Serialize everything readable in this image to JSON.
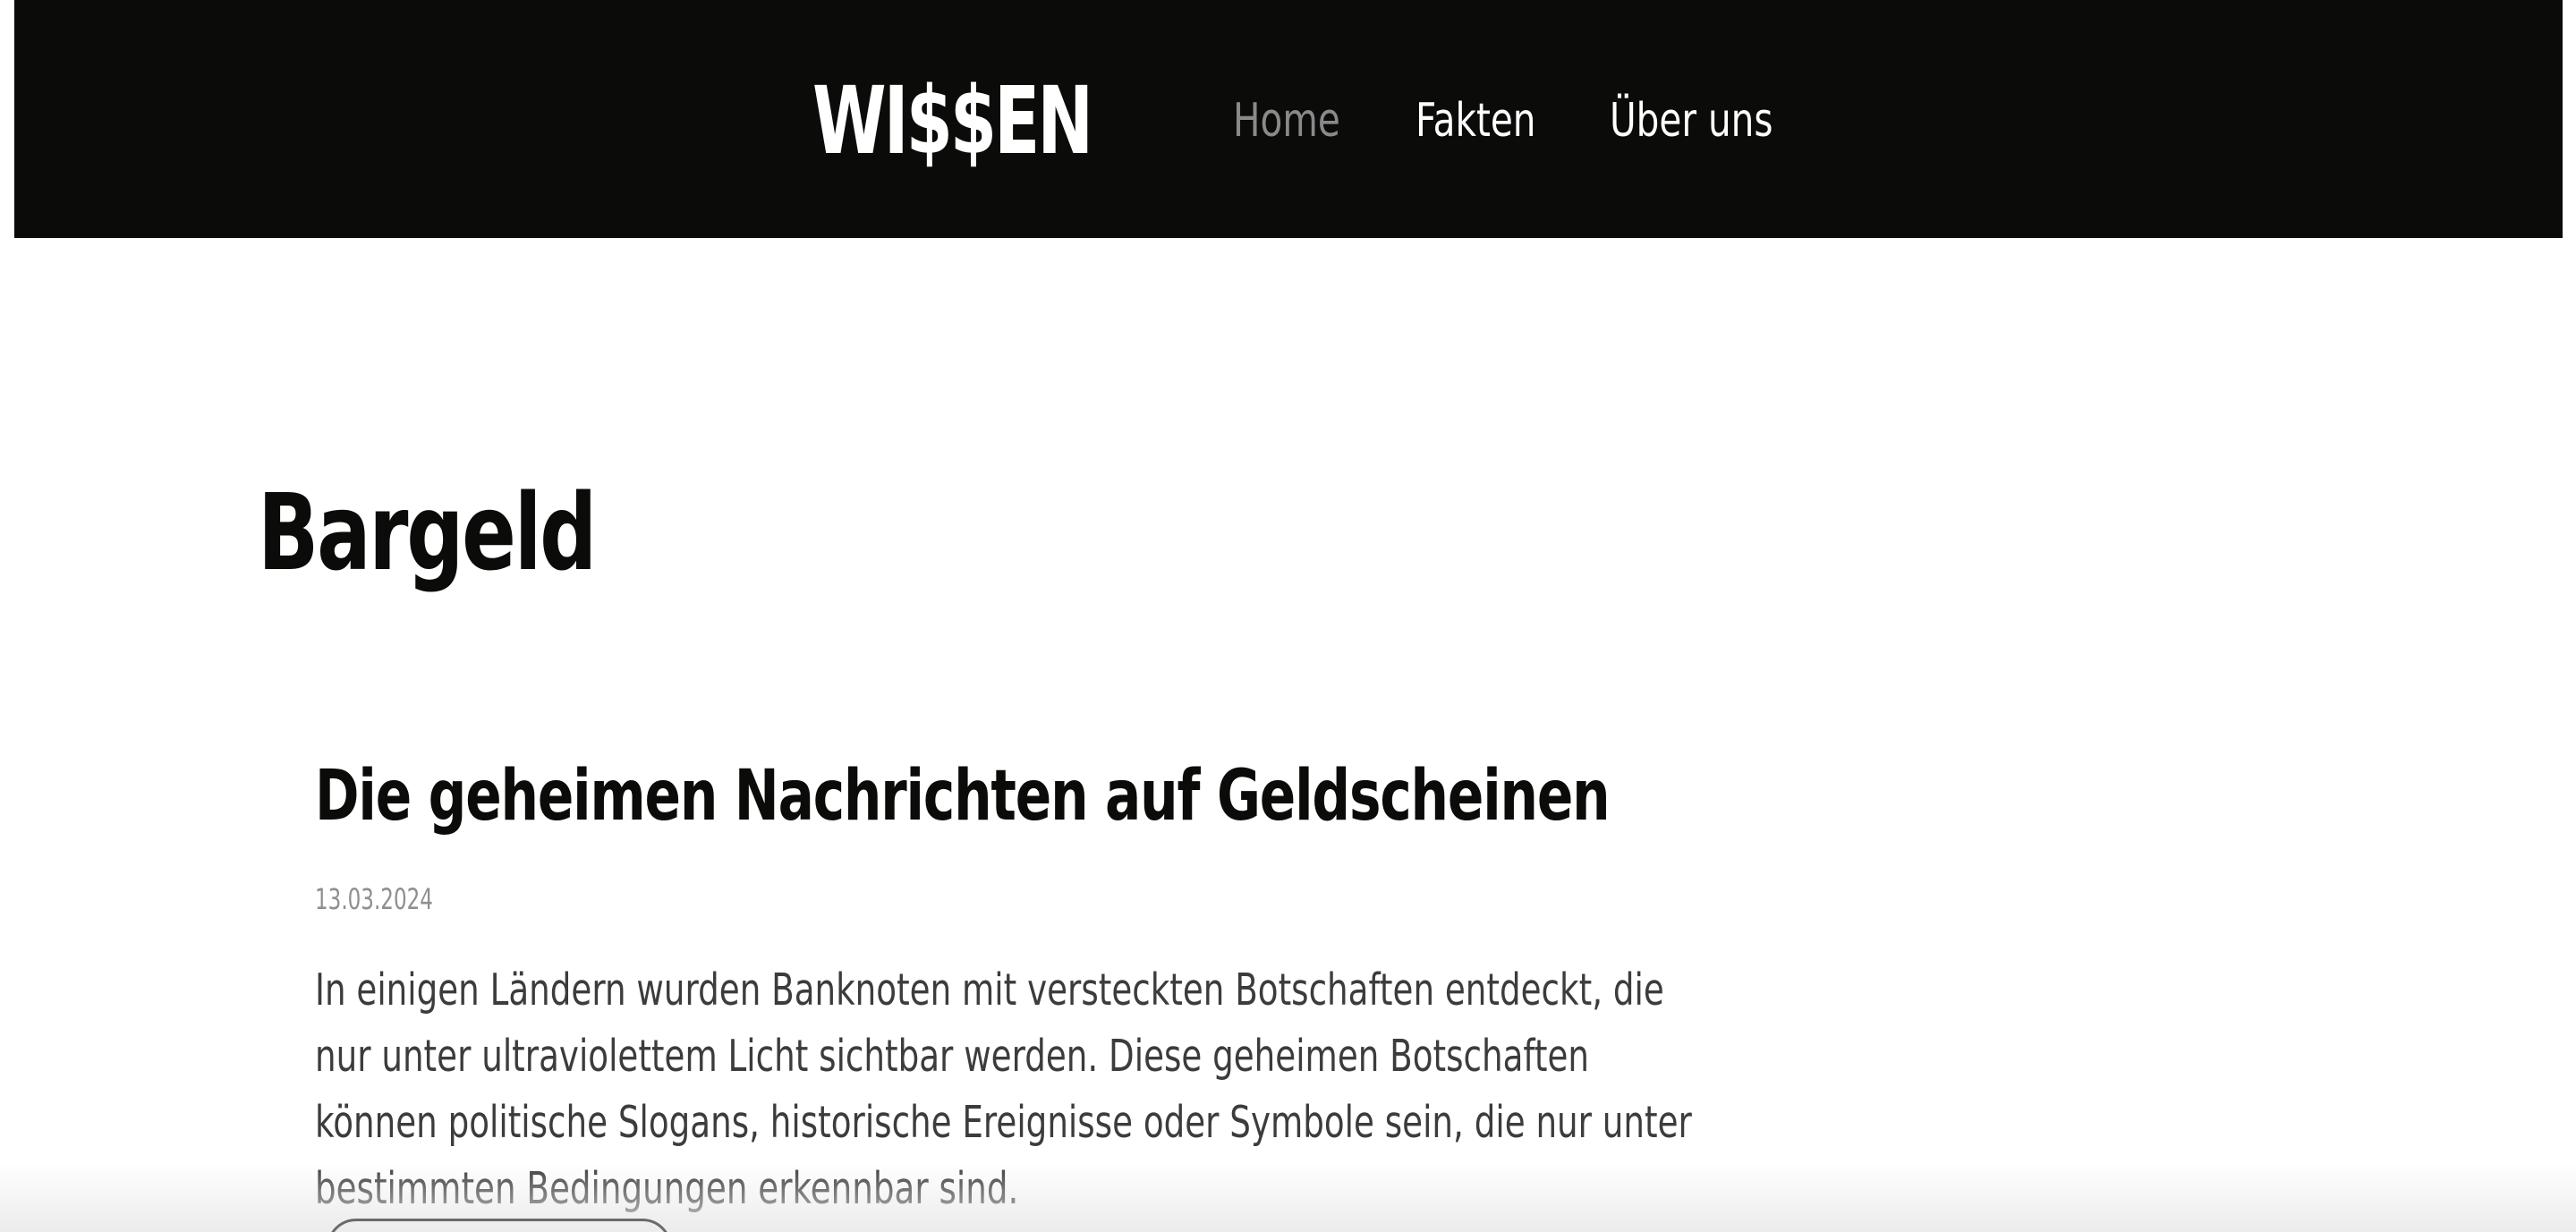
{
  "header": {
    "logo": "WI$$EN",
    "nav": {
      "home": "Home",
      "fakten": "Fakten",
      "ueber_uns": "Über uns"
    }
  },
  "main": {
    "page_title": "Bargeld",
    "article": {
      "title": "Die geheimen Nachrichten auf Geldscheinen",
      "date": "13.03.2024",
      "text": "In einigen Ländern wurden Banknoten mit versteckten Botschaften entdeckt, die nur unter ultraviolettem Licht sichtbar werden. Diese geheimen Botschaften können politische Slogans, historische Ereignisse oder Symbole sein, die nur unter bestimmten Bedingungen erkennbar sind."
    }
  },
  "colors": {
    "header_bg": "#0b0b0a",
    "nav_active": "#8a8a8a",
    "nav_inactive": "#ffffff",
    "heading": "#0b0b0a",
    "body_text": "#3c3c3c",
    "date_text": "#8f8f8f"
  }
}
